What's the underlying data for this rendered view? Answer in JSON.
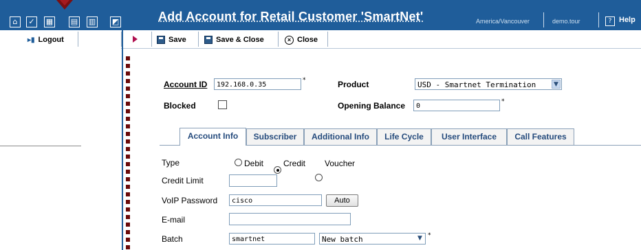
{
  "window": {
    "title": "Add Account for Retail Customer 'SmartNet'"
  },
  "topbar": {
    "timezone": "America/Vancouver",
    "user": "demo.tour",
    "help_label": "Help",
    "icons": [
      "home-icon",
      "checklist-icon",
      "calculator-icon",
      "report-icon",
      "grid-icon",
      "chart-icon"
    ]
  },
  "toolbar": {
    "logout_label": "Logout",
    "save_label": "Save",
    "save_close_label": "Save & Close",
    "close_label": "Close"
  },
  "form": {
    "account_id": {
      "label": "Account ID",
      "value": "192.168.0.35"
    },
    "product": {
      "label": "Product",
      "value": "USD - Smartnet Termination"
    },
    "blocked": {
      "label": "Blocked",
      "checked": false
    },
    "opening_balance": {
      "label": "Opening Balance",
      "value": "0"
    }
  },
  "tabs": [
    {
      "label": "Account Info",
      "active": true
    },
    {
      "label": "Subscriber",
      "active": false
    },
    {
      "label": "Additional Info",
      "active": false
    },
    {
      "label": "Life Cycle",
      "active": false
    },
    {
      "label": "User Interface",
      "active": false
    },
    {
      "label": "Call Features",
      "active": false
    }
  ],
  "account_info": {
    "type": {
      "label": "Type",
      "options": [
        "Debit",
        "Credit",
        "Voucher"
      ],
      "selected": "Credit"
    },
    "credit_limit": {
      "label": "Credit Limit",
      "value": ""
    },
    "voip_password": {
      "label": "VoIP Password",
      "value": "cisco",
      "auto_label": "Auto"
    },
    "email": {
      "label": "E-mail",
      "value": ""
    },
    "batch": {
      "label": "Batch",
      "value": "smartnet",
      "select_value": "New batch"
    }
  },
  "colors": {
    "topbar": "#1f5d9a",
    "tab_text": "#244a7c",
    "marker": "#7a0f12"
  }
}
